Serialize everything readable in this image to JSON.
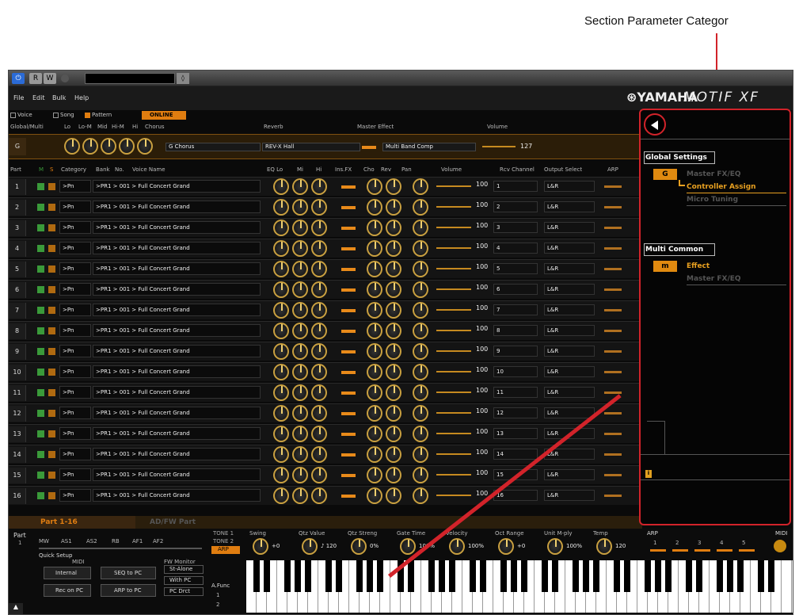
{
  "annotation": {
    "label": "Section Parameter Categor"
  },
  "titlebar": {
    "buttons": [
      "R",
      "W"
    ]
  },
  "menu": {
    "items": [
      "File",
      "Edit",
      "Bulk",
      "Help"
    ],
    "logo_brand": "YAMAHA",
    "logo_product": "MOTIF XF"
  },
  "modes": {
    "voice": "Voice",
    "song": "Song",
    "pattern": "Pattern",
    "online": "ONLINE"
  },
  "global_header": {
    "global_multi": "Global/Multi",
    "lo": "Lo",
    "lo_m": "Lo-M",
    "mid": "Mid",
    "hi_m": "Hi-M",
    "hi": "Hi",
    "chorus": "Chorus",
    "reverb": "Reverb",
    "master_effect": "Master Effect",
    "volume": "Volume"
  },
  "global_row": {
    "label": "G",
    "chorus": "G Chorus",
    "reverb": "REV-X Hall",
    "master_effect": "Multi Band Comp",
    "volume": "127"
  },
  "part_header": {
    "part": "Part",
    "m": "M",
    "s": "S",
    "category": "Category",
    "bank": "Bank",
    "no": "No.",
    "voice_name": "Voice Name",
    "eq_lo": "EQ Lo",
    "eq_mi": "Mi",
    "eq_hi": "Hi",
    "ins_fx": "Ins.FX",
    "cho": "Cho",
    "rev": "Rev",
    "pan": "Pan",
    "volume": "Volume",
    "rcv_channel": "Rcv Channel",
    "output_select": "Output Select",
    "arp": "ARP"
  },
  "parts": [
    {
      "num": "1",
      "category": ">Pn",
      "voice": ">PR1 > 001 > Full Concert Grand",
      "volume": "100",
      "channel": "1",
      "output": "L&R"
    },
    {
      "num": "2",
      "category": ">Pn",
      "voice": ">PR1 > 001 > Full Concert Grand",
      "volume": "100",
      "channel": "2",
      "output": "L&R"
    },
    {
      "num": "3",
      "category": ">Pn",
      "voice": ">PR1 > 001 > Full Concert Grand",
      "volume": "100",
      "channel": "3",
      "output": "L&R"
    },
    {
      "num": "4",
      "category": ">Pn",
      "voice": ">PR1 > 001 > Full Concert Grand",
      "volume": "100",
      "channel": "4",
      "output": "L&R"
    },
    {
      "num": "5",
      "category": ">Pn",
      "voice": ">PR1 > 001 > Full Concert Grand",
      "volume": "100",
      "channel": "5",
      "output": "L&R"
    },
    {
      "num": "6",
      "category": ">Pn",
      "voice": ">PR1 > 001 > Full Concert Grand",
      "volume": "100",
      "channel": "6",
      "output": "L&R"
    },
    {
      "num": "7",
      "category": ">Pn",
      "voice": ">PR1 > 001 > Full Concert Grand",
      "volume": "100",
      "channel": "7",
      "output": "L&R"
    },
    {
      "num": "8",
      "category": ">Pn",
      "voice": ">PR1 > 001 > Full Concert Grand",
      "volume": "100",
      "channel": "8",
      "output": "L&R"
    },
    {
      "num": "9",
      "category": ">Pn",
      "voice": ">PR1 > 001 > Full Concert Grand",
      "volume": "100",
      "channel": "9",
      "output": "L&R"
    },
    {
      "num": "10",
      "category": ">Pn",
      "voice": ">PR1 > 001 > Full Concert Grand",
      "volume": "100",
      "channel": "10",
      "output": "L&R"
    },
    {
      "num": "11",
      "category": ">Pn",
      "voice": ">PR1 > 001 > Full Concert Grand",
      "volume": "100",
      "channel": "11",
      "output": "L&R"
    },
    {
      "num": "12",
      "category": ">Pn",
      "voice": ">PR1 > 001 > Full Concert Grand",
      "volume": "100",
      "channel": "12",
      "output": "L&R"
    },
    {
      "num": "13",
      "category": ">Pn",
      "voice": ">PR1 > 001 > Full Concert Grand",
      "volume": "100",
      "channel": "13",
      "output": "L&R"
    },
    {
      "num": "14",
      "category": ">Pn",
      "voice": ">PR1 > 001 > Full Concert Grand",
      "volume": "100",
      "channel": "14",
      "output": "L&R"
    },
    {
      "num": "15",
      "category": ">Pn",
      "voice": ">PR1 > 001 > Full Concert Grand",
      "volume": "100",
      "channel": "15",
      "output": "L&R"
    },
    {
      "num": "16",
      "category": ">Pn",
      "voice": ">PR1 > 001 > Full Concert Grand",
      "volume": "100",
      "channel": "16",
      "output": "L&R"
    }
  ],
  "tabs": {
    "tab1": "Part 1-16",
    "tab2": "AD/FW Part"
  },
  "bottom": {
    "part_label": "Part",
    "part_value": "1",
    "assign": [
      "MW",
      "AS1",
      "AS2",
      "RB",
      "AF1",
      "AF2"
    ],
    "quick_setup": "Quick Setup",
    "midi_label": "MIDI",
    "fw_monitor": "FW Monitor",
    "buttons": [
      "Internal",
      "SEQ to PC",
      "Rec on PC",
      "ARP to PC"
    ],
    "monitor_opts": [
      "St-Alone",
      "With PC",
      "PC Drct"
    ],
    "tone_opts": [
      "TONE 1",
      "TONE 2",
      "ARP"
    ],
    "afunc": "A.Func",
    "afunc_vals": [
      "1",
      "2"
    ],
    "params": [
      {
        "label": "Swing",
        "value": "+0"
      },
      {
        "label": "Qtz Value",
        "value": "♪ 120"
      },
      {
        "label": "Qtz Streng",
        "value": "0%"
      },
      {
        "label": "Gate Time",
        "value": "100%"
      },
      {
        "label": "Velocity",
        "value": "100%"
      },
      {
        "label": "Oct Range",
        "value": "+0"
      },
      {
        "label": "Unit M-ply",
        "value": "100%"
      },
      {
        "label": "Temp",
        "value": "120"
      }
    ],
    "arp_label": "ARP",
    "arp_nums": [
      "1",
      "2",
      "3",
      "4",
      "5"
    ],
    "midi_right": "MIDI"
  },
  "right_panel": {
    "global_settings": "Global Settings",
    "g_icon": "G",
    "global_items": [
      "Master FX/EQ",
      "Controller Assign",
      "Micro Tuning"
    ],
    "multi_common": "Multi Common",
    "m_icon": "m",
    "multi_items": [
      "Effect",
      "Master FX/EQ"
    ],
    "info_icon": "i"
  },
  "colors": {
    "accent": "#e07d10",
    "annotation": "#d2232a",
    "active_text": "#e8a020"
  }
}
